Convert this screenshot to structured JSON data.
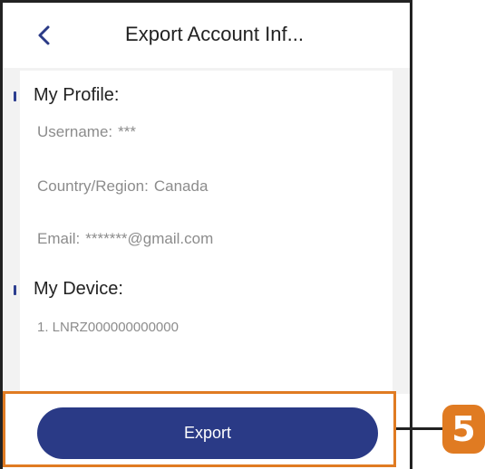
{
  "header": {
    "title": "Export Account Inf..."
  },
  "profile": {
    "section_title": "My Profile:",
    "username_label": "Username:",
    "username_value": "***",
    "country_label": "Country/Region:",
    "country_value": "Canada",
    "email_label": "Email:",
    "email_value": "*******@gmail.com"
  },
  "device": {
    "section_title": "My Device:",
    "items": [
      "1. LNRZ000000000000"
    ]
  },
  "footer": {
    "export_label": "Export"
  },
  "annotation": {
    "step_number": "5"
  },
  "colors": {
    "accent": "#2a3a86",
    "callout": "#e07b22"
  },
  "icons": {
    "back": "chevron-left-icon"
  }
}
